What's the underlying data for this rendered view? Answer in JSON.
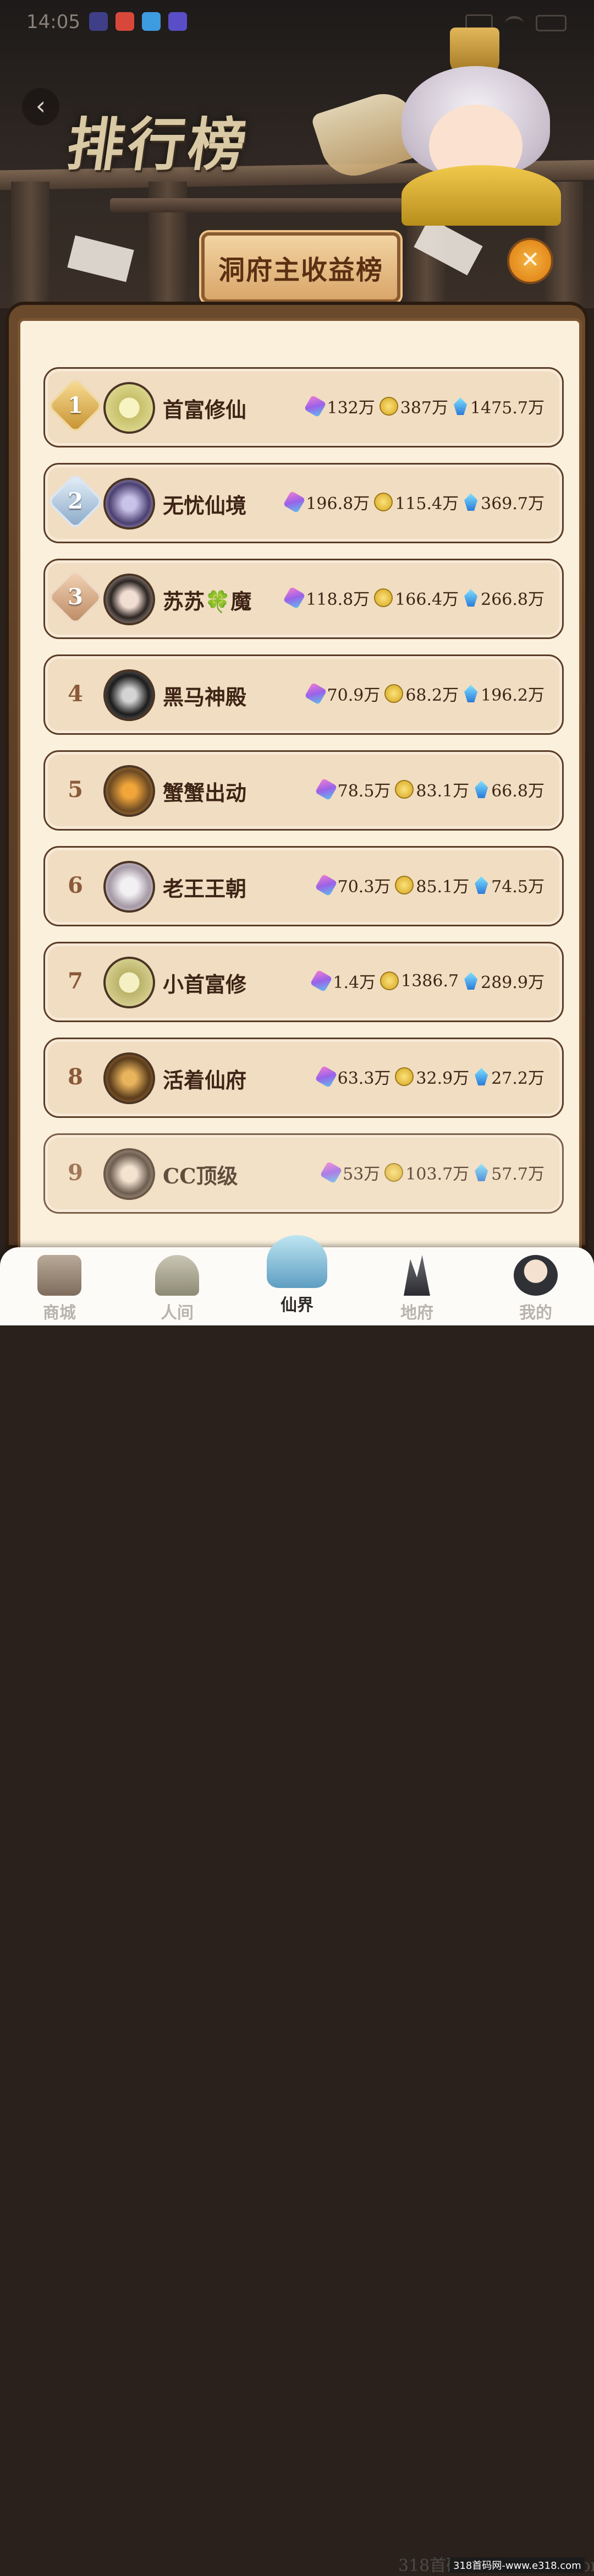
{
  "status_bar": {
    "time": "14:05"
  },
  "header": {
    "title": "排行榜",
    "banner": "洞府主收益榜",
    "back_icon": "‹",
    "close_icon": "✕"
  },
  "rankings": [
    {
      "rank": "1",
      "name": "首富修仙",
      "gem": "132万",
      "coin": "387万",
      "crystal": "1475.7万"
    },
    {
      "rank": "2",
      "name": "无忧仙境",
      "gem": "196.8万",
      "coin": "115.4万",
      "crystal": "369.7万"
    },
    {
      "rank": "3",
      "name": "苏苏",
      "name_emoji": "🍀",
      "name_suffix": "魔",
      "gem": "118.8万",
      "coin": "166.4万",
      "crystal": "266.8万"
    },
    {
      "rank": "4",
      "name": "黑马神殿",
      "gem": "70.9万",
      "coin": "68.2万",
      "crystal": "196.2万"
    },
    {
      "rank": "5",
      "name": "蟹蟹出动",
      "gem": "78.5万",
      "coin": "83.1万",
      "crystal": "66.8万"
    },
    {
      "rank": "6",
      "name": "老王王朝",
      "gem": "70.3万",
      "coin": "85.1万",
      "crystal": "74.5万"
    },
    {
      "rank": "7",
      "name": "小首富修",
      "gem": "1.4万",
      "coin": "1386.7",
      "crystal": "289.9万"
    },
    {
      "rank": "8",
      "name": "活着仙府",
      "gem": "63.3万",
      "coin": "32.9万",
      "crystal": "27.2万"
    },
    {
      "rank": "9",
      "name": "CC顶级",
      "gem": "53万",
      "coin": "103.7万",
      "crystal": "57.7万"
    }
  ],
  "nav": [
    {
      "label": "商城"
    },
    {
      "label": "人间"
    },
    {
      "label": "仙界"
    },
    {
      "label": "地府"
    },
    {
      "label": "我的"
    }
  ],
  "watermark": "318首码网www.e318.com",
  "watermark_badge": "318首码网-www.e318.com"
}
